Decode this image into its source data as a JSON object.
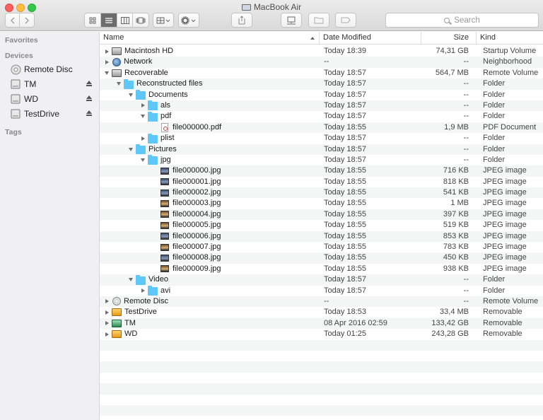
{
  "window": {
    "title": "MacBook Air",
    "search_placeholder": "Search",
    "accent": "#5fc7f8"
  },
  "toolbar": {
    "back_icon": "chevron-left-icon",
    "forward_icon": "chevron-right-icon",
    "view_modes": [
      "icon-view-icon",
      "list-view-icon",
      "column-view-icon",
      "cover-flow-icon"
    ],
    "arrange_icon": "grid-icon",
    "action_icon": "gear-icon",
    "share_icon": "share-icon",
    "connect_icon": "network-drive-icon",
    "new_folder_icon": "folder-icon",
    "tag_icon": "tag-icon"
  },
  "sidebar": {
    "favorites_label": "Favorites",
    "devices_label": "Devices",
    "tags_label": "Tags",
    "devices": [
      {
        "label": "Remote Disc",
        "icon": "cd-icon",
        "eject": false
      },
      {
        "label": "TM",
        "icon": "drive-icon",
        "eject": true
      },
      {
        "label": "WD",
        "icon": "drive-icon",
        "eject": true
      },
      {
        "label": "TestDrive",
        "icon": "drive-icon",
        "eject": true
      }
    ]
  },
  "columns": {
    "name": "Name",
    "date": "Date Modified",
    "size": "Size",
    "kind": "Kind"
  },
  "rows": [
    {
      "name": "Macintosh HD",
      "date": "Today 18:39",
      "size": "74,31 GB",
      "kind": "Startup Volume",
      "level": 0,
      "disclosure": "closed",
      "icon": "disk"
    },
    {
      "name": "Network",
      "date": "--",
      "size": "--",
      "kind": "Neighborhood",
      "level": 0,
      "disclosure": "closed",
      "icon": "globe"
    },
    {
      "name": "Recoverable",
      "date": "Today 18:57",
      "size": "564,7 MB",
      "kind": "Remote Volume",
      "level": 0,
      "disclosure": "open",
      "icon": "disk"
    },
    {
      "name": "Reconstructed files",
      "date": "Today 18:57",
      "size": "--",
      "kind": "Folder",
      "level": 1,
      "disclosure": "open",
      "icon": "folder"
    },
    {
      "name": "Documents",
      "date": "Today 18:57",
      "size": "--",
      "kind": "Folder",
      "level": 2,
      "disclosure": "open",
      "icon": "folder"
    },
    {
      "name": "als",
      "date": "Today 18:57",
      "size": "--",
      "kind": "Folder",
      "level": 3,
      "disclosure": "closed",
      "icon": "folder"
    },
    {
      "name": "pdf",
      "date": "Today 18:57",
      "size": "--",
      "kind": "Folder",
      "level": 3,
      "disclosure": "open",
      "icon": "folder"
    },
    {
      "name": "file000000.pdf",
      "date": "Today 18:55",
      "size": "1,9 MB",
      "kind": "PDF Document",
      "level": 4,
      "disclosure": "none",
      "icon": "pdf"
    },
    {
      "name": "plist",
      "date": "Today 18:57",
      "size": "--",
      "kind": "Folder",
      "level": 3,
      "disclosure": "closed",
      "icon": "folder"
    },
    {
      "name": "Pictures",
      "date": "Today 18:57",
      "size": "--",
      "kind": "Folder",
      "level": 2,
      "disclosure": "open",
      "icon": "folder"
    },
    {
      "name": "jpg",
      "date": "Today 18:57",
      "size": "--",
      "kind": "Folder",
      "level": 3,
      "disclosure": "open",
      "icon": "folder"
    },
    {
      "name": "file000000.jpg",
      "date": "Today 18:55",
      "size": "716 KB",
      "kind": "JPEG image",
      "level": 4,
      "disclosure": "none",
      "icon": "jpg"
    },
    {
      "name": "file000001.jpg",
      "date": "Today 18:55",
      "size": "818 KB",
      "kind": "JPEG image",
      "level": 4,
      "disclosure": "none",
      "icon": "jpg"
    },
    {
      "name": "file000002.jpg",
      "date": "Today 18:55",
      "size": "541 KB",
      "kind": "JPEG image",
      "level": 4,
      "disclosure": "none",
      "icon": "jpg"
    },
    {
      "name": "file000003.jpg",
      "date": "Today 18:55",
      "size": "1 MB",
      "kind": "JPEG image",
      "level": 4,
      "disclosure": "none",
      "icon": "jpg-warm"
    },
    {
      "name": "file000004.jpg",
      "date": "Today 18:55",
      "size": "397 KB",
      "kind": "JPEG image",
      "level": 4,
      "disclosure": "none",
      "icon": "jpg-warm"
    },
    {
      "name": "file000005.jpg",
      "date": "Today 18:55",
      "size": "519 KB",
      "kind": "JPEG image",
      "level": 4,
      "disclosure": "none",
      "icon": "jpg-warm"
    },
    {
      "name": "file000006.jpg",
      "date": "Today 18:55",
      "size": "853 KB",
      "kind": "JPEG image",
      "level": 4,
      "disclosure": "none",
      "icon": "jpg"
    },
    {
      "name": "file000007.jpg",
      "date": "Today 18:55",
      "size": "783 KB",
      "kind": "JPEG image",
      "level": 4,
      "disclosure": "none",
      "icon": "jpg-warm"
    },
    {
      "name": "file000008.jpg",
      "date": "Today 18:55",
      "size": "450 KB",
      "kind": "JPEG image",
      "level": 4,
      "disclosure": "none",
      "icon": "jpg"
    },
    {
      "name": "file000009.jpg",
      "date": "Today 18:55",
      "size": "938 KB",
      "kind": "JPEG image",
      "level": 4,
      "disclosure": "none",
      "icon": "jpg-warm"
    },
    {
      "name": "Video",
      "date": "Today 18:57",
      "size": "--",
      "kind": "Folder",
      "level": 2,
      "disclosure": "open",
      "icon": "folder"
    },
    {
      "name": "avi",
      "date": "Today 18:57",
      "size": "--",
      "kind": "Folder",
      "level": 3,
      "disclosure": "closed",
      "icon": "folder"
    },
    {
      "name": "Remote Disc",
      "date": "--",
      "size": "--",
      "kind": "Remote Volume",
      "level": 0,
      "disclosure": "closed",
      "icon": "cd"
    },
    {
      "name": "TestDrive",
      "date": "Today 18:53",
      "size": "33,4 MB",
      "kind": "Removable",
      "level": 0,
      "disclosure": "closed",
      "icon": "orange"
    },
    {
      "name": "TM",
      "date": "08 Apr 2016 02:59",
      "size": "133,42 GB",
      "kind": "Removable",
      "level": 0,
      "disclosure": "closed",
      "icon": "tm"
    },
    {
      "name": "WD",
      "date": "Today 01:25",
      "size": "243,28 GB",
      "kind": "Removable",
      "level": 0,
      "disclosure": "closed",
      "icon": "orange"
    }
  ]
}
